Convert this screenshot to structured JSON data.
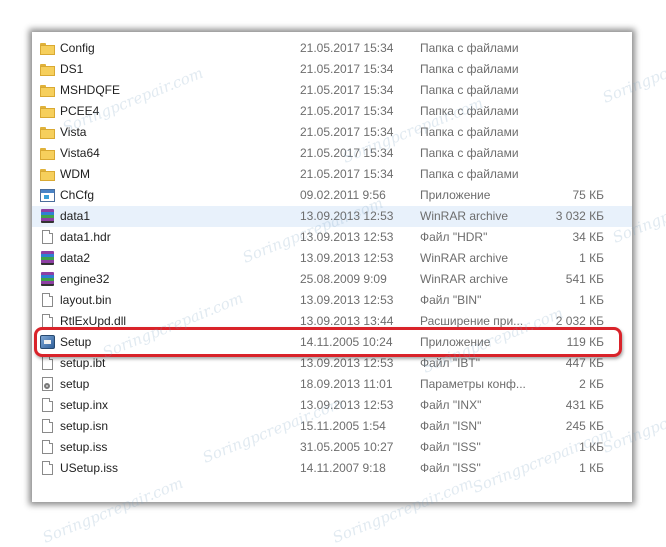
{
  "watermark": "Soringpcrepair.com",
  "files": [
    {
      "name": "Config",
      "date": "21.05.2017 15:34",
      "type": "Папка с файлами",
      "size": "",
      "icon": "folder-icon"
    },
    {
      "name": "DS1",
      "date": "21.05.2017 15:34",
      "type": "Папка с файлами",
      "size": "",
      "icon": "folder-icon"
    },
    {
      "name": "MSHDQFE",
      "date": "21.05.2017 15:34",
      "type": "Папка с файлами",
      "size": "",
      "icon": "folder-icon"
    },
    {
      "name": "PCEE4",
      "date": "21.05.2017 15:34",
      "type": "Папка с файлами",
      "size": "",
      "icon": "folder-icon"
    },
    {
      "name": "Vista",
      "date": "21.05.2017 15:34",
      "type": "Папка с файлами",
      "size": "",
      "icon": "folder-icon"
    },
    {
      "name": "Vista64",
      "date": "21.05.2017 15:34",
      "type": "Папка с файлами",
      "size": "",
      "icon": "folder-icon"
    },
    {
      "name": "WDM",
      "date": "21.05.2017 15:34",
      "type": "Папка с файлами",
      "size": "",
      "icon": "folder-icon"
    },
    {
      "name": "ChCfg",
      "date": "09.02.2011 9:56",
      "type": "Приложение",
      "size": "75 КБ",
      "icon": "application-icon"
    },
    {
      "name": "data1",
      "date": "13.09.2013 12:53",
      "type": "WinRAR archive",
      "size": "3 032 КБ",
      "icon": "winrar-archive-icon"
    },
    {
      "name": "data1.hdr",
      "date": "13.09.2013 12:53",
      "type": "Файл \"HDR\"",
      "size": "34 КБ",
      "icon": "document-icon"
    },
    {
      "name": "data2",
      "date": "13.09.2013 12:53",
      "type": "WinRAR archive",
      "size": "1 КБ",
      "icon": "winrar-archive-icon"
    },
    {
      "name": "engine32",
      "date": "25.08.2009 9:09",
      "type": "WinRAR archive",
      "size": "541 КБ",
      "icon": "winrar-archive-icon"
    },
    {
      "name": "layout.bin",
      "date": "13.09.2013 12:53",
      "type": "Файл \"BIN\"",
      "size": "1 КБ",
      "icon": "document-icon"
    },
    {
      "name": "RtlExUpd.dll",
      "date": "13.09.2013 13:44",
      "type": "Расширение при...",
      "size": "2 032 КБ",
      "icon": "document-icon"
    },
    {
      "name": "Setup",
      "date": "14.11.2005 10:24",
      "type": "Приложение",
      "size": "119 КБ",
      "icon": "setup-icon"
    },
    {
      "name": "setup.ibt",
      "date": "13.09.2013 12:53",
      "type": "Файл \"IBT\"",
      "size": "447 КБ",
      "icon": "document-icon"
    },
    {
      "name": "setup",
      "date": "18.09.2013 11:01",
      "type": "Параметры конф...",
      "size": "2 КБ",
      "icon": "settings-file-icon"
    },
    {
      "name": "setup.inx",
      "date": "13.09.2013 12:53",
      "type": "Файл \"INX\"",
      "size": "431 КБ",
      "icon": "document-icon"
    },
    {
      "name": "setup.isn",
      "date": "15.11.2005 1:54",
      "type": "Файл \"ISN\"",
      "size": "245 КБ",
      "icon": "document-icon"
    },
    {
      "name": "setup.iss",
      "date": "31.05.2005 10:27",
      "type": "Файл \"ISS\"",
      "size": "1 КБ",
      "icon": "document-icon"
    },
    {
      "name": "USetup.iss",
      "date": "14.11.2007 9:18",
      "type": "Файл \"ISS\"",
      "size": "1 КБ",
      "icon": "document-icon"
    }
  ],
  "selected_index": 8,
  "highlighted_index": 14,
  "colors": {
    "highlight_border": "#d9232a",
    "selection": "#e8f1fb"
  }
}
